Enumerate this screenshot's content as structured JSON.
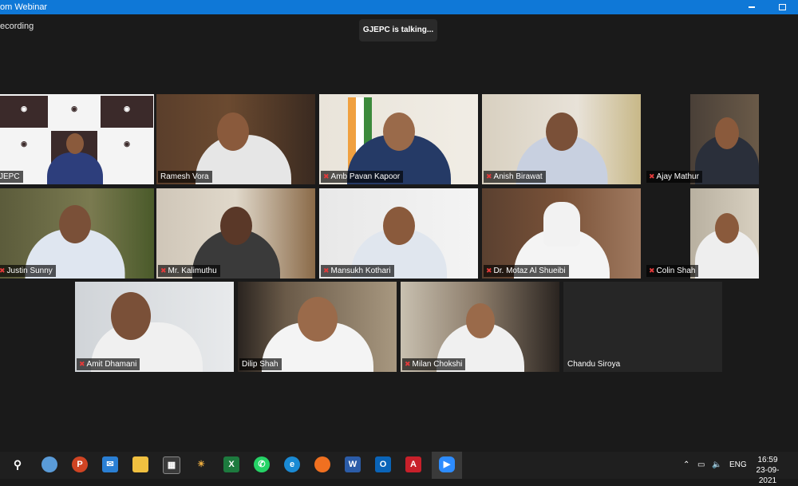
{
  "window": {
    "title": "om Webinar",
    "controls": {
      "minimize": "minimize-icon",
      "restore": "restore-icon"
    }
  },
  "status": {
    "recording": "ecording",
    "talking": "GJEPC is talking..."
  },
  "participants": [
    {
      "name": "JEPC",
      "muted": false,
      "active": true,
      "logo_text": "GJEPC"
    },
    {
      "name": "Ramesh Vora",
      "muted": false
    },
    {
      "name": "Amb Pavan Kapoor",
      "muted": true
    },
    {
      "name": "Anish Birawat",
      "muted": true
    },
    {
      "name": "Ajay Mathur",
      "muted": true
    },
    {
      "name": "Justin Sunny",
      "muted": true
    },
    {
      "name": "Mr. Kalimuthu",
      "muted": true
    },
    {
      "name": "Mansukh Kothari",
      "muted": true
    },
    {
      "name": "Dr. Motaz Al Shueibi",
      "muted": true
    },
    {
      "name": "Colin Shah",
      "muted": true
    },
    {
      "name": "Amit Dhamani",
      "muted": true
    },
    {
      "name": "Dilip Shah",
      "muted": false
    },
    {
      "name": "Milan Chokshi",
      "muted": true
    },
    {
      "name": "Chandu Siroya",
      "muted": false,
      "video_off": true
    }
  ],
  "taskbar": {
    "apps": [
      "search-icon",
      "ms-paint-icon",
      "powerpoint-icon",
      "mail-icon",
      "file-explorer-icon",
      "store-icon",
      "weather-icon",
      "excel-icon",
      "whatsapp-icon",
      "edge-icon",
      "firefox-icon",
      "word-icon",
      "outlook-icon",
      "acrobat-icon",
      "zoom-icon"
    ],
    "tray": {
      "language": "ENG"
    },
    "clock": {
      "time": "16:59",
      "date": "23-09-2021"
    }
  },
  "colors": {
    "titlebar": "#0f78d7",
    "active_speaker": "#a5d632",
    "muted_mic": "#e23a3a",
    "background": "#1a1a1a"
  }
}
